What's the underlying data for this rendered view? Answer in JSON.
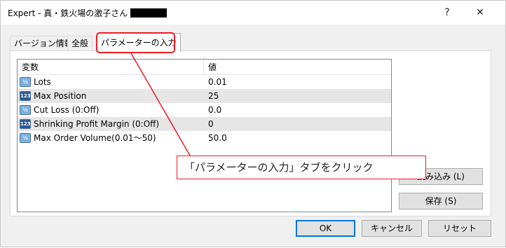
{
  "window": {
    "title": "Expert - 真・鉄火場の激子さん",
    "help_glyph": "?",
    "close_glyph": "✕"
  },
  "tabs": [
    {
      "label": "バージョン情報"
    },
    {
      "label": "全般"
    },
    {
      "label": "パラメーターの入力",
      "active": true
    }
  ],
  "table": {
    "columns": [
      "変数",
      "値"
    ],
    "rows": [
      {
        "type": "double",
        "icon_label": "½",
        "name": "Lots",
        "value": "0.01"
      },
      {
        "type": "int",
        "icon_label": "123",
        "name": "Max Position",
        "value": "25"
      },
      {
        "type": "double",
        "icon_label": "½",
        "name": "Cut Loss (0:Off)",
        "value": "0.0"
      },
      {
        "type": "int",
        "icon_label": "123",
        "name": "Shrinking Profit Margin (0:Off)",
        "value": "0"
      },
      {
        "type": "double",
        "icon_label": "½",
        "name": "Max Order Volume(0.01～50)",
        "value": "50.0"
      }
    ]
  },
  "side_buttons": {
    "load_label": "読み込み (L)",
    "save_label": "保存 (S)"
  },
  "footer": {
    "ok_label": "OK",
    "cancel_label": "キャンセル",
    "reset_label": "リセット"
  },
  "annotation": {
    "text": "「パラメーターの入力」タブをクリック",
    "color": "#ee1c24"
  }
}
